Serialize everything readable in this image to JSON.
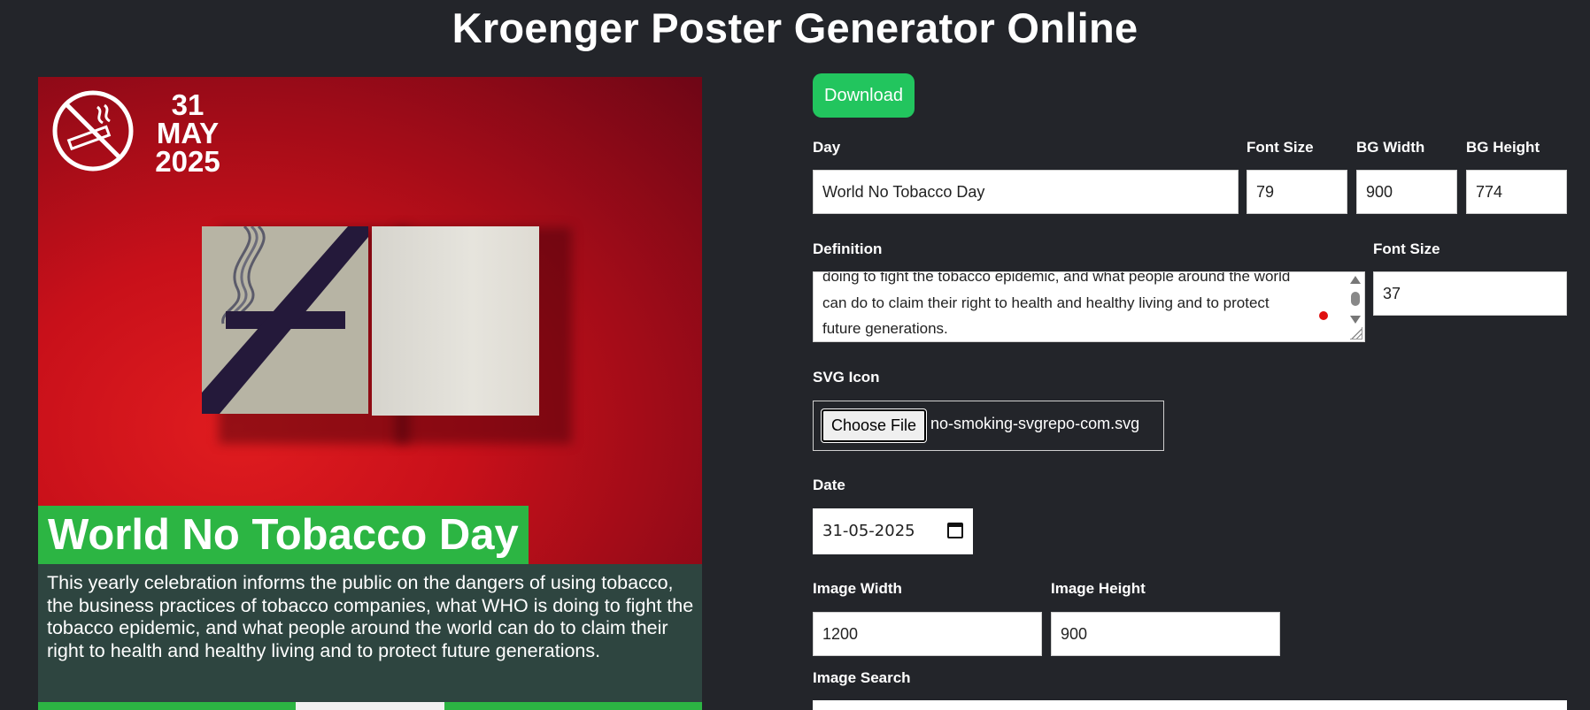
{
  "app": {
    "title": "Kroenger Poster Generator Online"
  },
  "poster": {
    "date_day": "31",
    "date_month": "MAY",
    "date_year": "2025",
    "day_title": "World No Tobacco Day",
    "definition": "This yearly celebration informs the public on the dangers of using tobacco, the business practices of tobacco companies, what WHO is doing to fight the tobacco epidemic, and what people around the world can do to claim their right to health and healthy living and to protect future generations.",
    "icon": "no-smoking-icon",
    "colors": {
      "accent": "#2cb543",
      "definition_bg": "#2e4540",
      "photo_bg": "#c81018"
    }
  },
  "form": {
    "download_label": "Download",
    "day": {
      "label": "Day",
      "value": "World No Tobacco Day"
    },
    "day_font_size": {
      "label": "Font Size",
      "value": "79"
    },
    "bg_width": {
      "label": "BG Width",
      "value": "900"
    },
    "bg_height": {
      "label": "BG Height",
      "value": "774"
    },
    "definition": {
      "label": "Definition",
      "visible_text": "doing to fight the tobacco epidemic, and what people around the world can do to claim their right to health and healthy living and to protect future generations."
    },
    "definition_font_size": {
      "label": "Font Size",
      "value": "37"
    },
    "svg_icon": {
      "label": "SVG Icon",
      "button_label": "Choose File",
      "file_name": "no-smoking-svgrepo-com.svg"
    },
    "date": {
      "label": "Date",
      "value": "31-05-2025"
    },
    "image_width": {
      "label": "Image Width",
      "value": "1200"
    },
    "image_height": {
      "label": "Image Height",
      "value": "900"
    },
    "image_search": {
      "label": "Image Search",
      "value": ""
    }
  },
  "colors": {
    "page_bg": "#23252a",
    "button_green": "#22c55e"
  }
}
